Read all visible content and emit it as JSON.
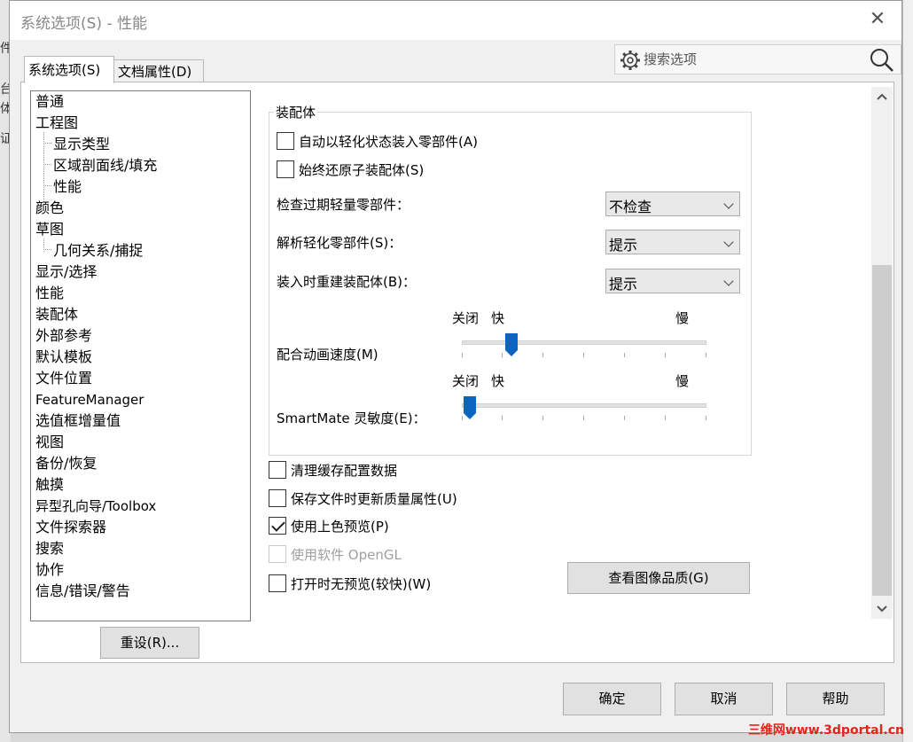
{
  "window": {
    "title": "系统选项(S) - 性能"
  },
  "tabs": [
    {
      "label": "系统选项(S)"
    },
    {
      "label": "文档属性(D)"
    }
  ],
  "search": {
    "placeholder": "搜索选项"
  },
  "tree": {
    "items": [
      {
        "label": "普通",
        "level": 0
      },
      {
        "label": "工程图",
        "level": 0
      },
      {
        "label": "显示类型",
        "level": 1
      },
      {
        "label": "区域剖面线/填充",
        "level": 1
      },
      {
        "label": "性能",
        "level": 1
      },
      {
        "label": "颜色",
        "level": 0
      },
      {
        "label": "草图",
        "level": 0
      },
      {
        "label": "几何关系/捕捉",
        "level": 1
      },
      {
        "label": "显示/选择",
        "level": 0
      },
      {
        "label": "性能",
        "level": 0
      },
      {
        "label": "装配体",
        "level": 0
      },
      {
        "label": "外部参考",
        "level": 0
      },
      {
        "label": "默认模板",
        "level": 0
      },
      {
        "label": "文件位置",
        "level": 0
      },
      {
        "label": "FeatureManager",
        "level": 0
      },
      {
        "label": "选值框增量值",
        "level": 0
      },
      {
        "label": "视图",
        "level": 0
      },
      {
        "label": "备份/恢复",
        "level": 0
      },
      {
        "label": "触摸",
        "level": 0
      },
      {
        "label": "异型孔向导/Toolbox",
        "level": 0
      },
      {
        "label": "文件探索器",
        "level": 0
      },
      {
        "label": "搜索",
        "level": 0
      },
      {
        "label": "协作",
        "level": 0
      },
      {
        "label": "信息/错误/警告",
        "level": 0
      }
    ]
  },
  "reset_button": {
    "label": "重设(R)..."
  },
  "assembly_group": {
    "title": "装配体",
    "checkbox_lightweight": {
      "label": "自动以轻化状态装入零部件(A)",
      "checked": false
    },
    "checkbox_restore": {
      "label": "始终还原子装配体(S)",
      "checked": false
    },
    "check_outdated": {
      "label": "检查过期轻量零部件：",
      "value": "不检查"
    },
    "resolve_lightweight": {
      "label": "解析轻化零部件(S)：",
      "value": "提示"
    },
    "rebuild_on_load": {
      "label": "装入时重建装配体(B)：",
      "value": "提示"
    },
    "mate_animation": {
      "label": "配合动画速度(M)",
      "off": "关闭",
      "fast": "快",
      "slow": "慢",
      "position_fraction": 0.18
    },
    "smartmate": {
      "label": "SmartMate 灵敏度(E)：",
      "off": "关闭",
      "fast": "快",
      "slow": "慢",
      "position_fraction": 0.0
    }
  },
  "options": {
    "clear_cache": {
      "label": "清理缓存配置数据",
      "checked": false
    },
    "update_mass": {
      "label": "保存文件时更新质量属性(U)",
      "checked": false
    },
    "shaded_preview": {
      "label": "使用上色预览(P)",
      "checked": true
    },
    "software_opengl": {
      "label": "使用软件 OpenGL",
      "checked": false,
      "disabled": true
    },
    "no_preview": {
      "label": "打开时无预览(较快)(W)",
      "checked": false
    }
  },
  "image_quality_button": {
    "label": "查看图像品质(G)"
  },
  "footer": {
    "ok": "确定",
    "cancel": "取消",
    "help": "帮助"
  },
  "watermark": {
    "text": "三维网www.3dportal.cn"
  },
  "colors": {
    "accent": "#0b64c0",
    "watermark": "#e5231b"
  }
}
